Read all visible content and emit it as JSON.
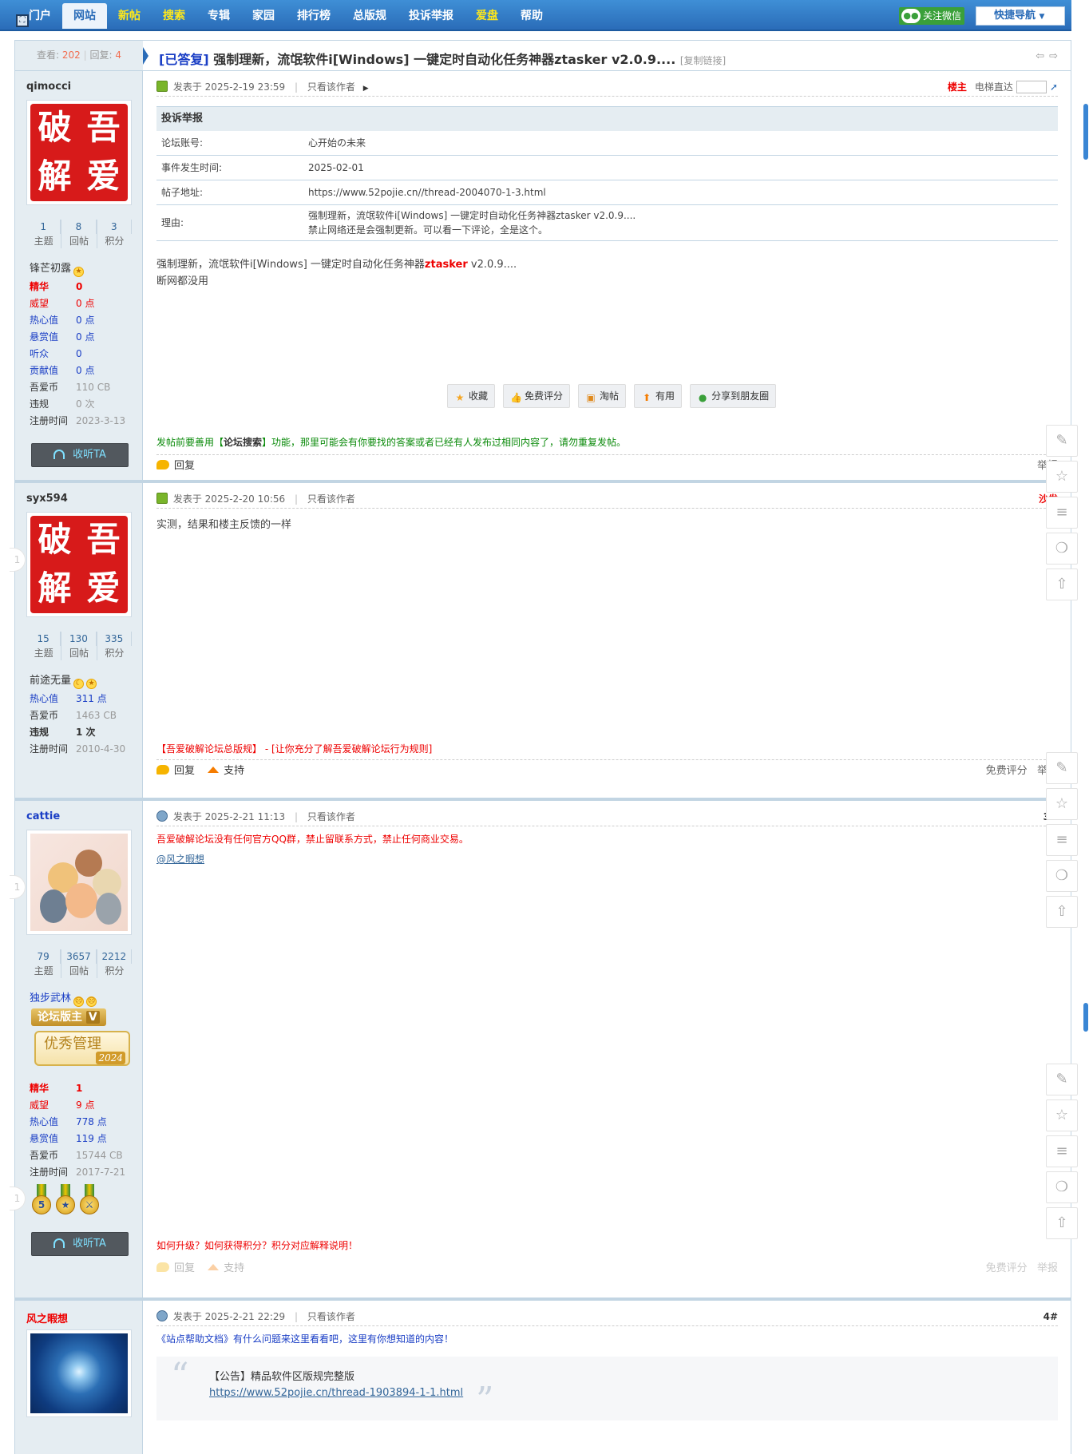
{
  "nav": {
    "items": [
      "门户",
      "网站",
      "新帖",
      "搜索",
      "专辑",
      "家园",
      "排行榜",
      "总版规",
      "投诉举报",
      "爱盘",
      "帮助"
    ],
    "wechat": "关注微信",
    "quick_nav": "快捷导航"
  },
  "thread": {
    "view_label": "查看:",
    "views": "202",
    "reply_label": "回复:",
    "replies": "4",
    "answered": "[已答复]",
    "title": "强制理新，流氓软件i[Windows] 一键定时自动化任务神器ztasker v2.0.9....",
    "copy_link": "[复制链接]"
  },
  "common": {
    "posted_at": "发表于",
    "only_author": "只看该作者",
    "reply": "回复",
    "support": "支持",
    "free_rate": "免费评分",
    "report": "举报",
    "follow": "收听TA",
    "elevator": "电梯直达",
    "topics": "主题",
    "posts": "回帖",
    "points": "积分"
  },
  "posts": [
    {
      "user": "qimocci",
      "stats": [
        "1",
        "8",
        "3"
      ],
      "rank": "锋芒初露",
      "info": [
        {
          "k": "精华",
          "v": "0"
        },
        {
          "k": "威望",
          "v": "0 点"
        },
        {
          "k": "热心值",
          "v": "0 点"
        },
        {
          "k": "悬赏值",
          "v": "0 点"
        },
        {
          "k": "听众",
          "v": "0"
        },
        {
          "k": "贡献值",
          "v": "0 点"
        },
        {
          "k": "吾爱币",
          "v": "110 CB"
        },
        {
          "k": "违规",
          "v": "0 次"
        },
        {
          "k": "注册时间",
          "v": "2023-3-13"
        }
      ],
      "time": "2025-2-19 23:59",
      "floor": "楼主",
      "report": {
        "title": "投诉举报",
        "rows": [
          {
            "k": "论坛账号:",
            "v": "心开始の未来"
          },
          {
            "k": "事件发生时间:",
            "v": "2025-02-01"
          },
          {
            "k": "帖子地址:",
            "v": "https://www.52pojie.cn//thread-2004070-1-3.html"
          },
          {
            "k": "理由:",
            "v": "强制理新，流氓软件i[Windows] 一键定时自动化任务神器ztasker v2.0.9....",
            "v2": "禁止网络还是会强制更新。可以看一下评论，全是这个。"
          }
        ]
      },
      "body_pre": "强制理新，流氓软件i[Windows] 一键定时自动化任务神器",
      "body_hl": "ztasker",
      "body_post": " v2.0.9....",
      "body_line2": "断网都没用",
      "actions": [
        "收藏",
        "免费评分",
        "淘帖",
        "有用",
        "分享到朋友圈"
      ],
      "tip_pre": "发帖前要善用【",
      "tip_b": "论坛搜索",
      "tip_post": "】功能，那里可能会有你要找的答案或者已经有人发布过相同内容了，请勿重复发帖。"
    },
    {
      "user": "syx594",
      "stats": [
        "15",
        "130",
        "335"
      ],
      "rank": "前途无量",
      "info": [
        {
          "k": "热心值",
          "v": "311 点"
        },
        {
          "k": "吾爱币",
          "v": "1463 CB"
        },
        {
          "k": "违规",
          "v": "1 次"
        },
        {
          "k": "注册时间",
          "v": "2010-4-30"
        }
      ],
      "time": "2025-2-20 10:56",
      "floor": "沙发",
      "body": "实测，结果和楼主反馈的一样",
      "notice": "【吾爱破解论坛总版规】 - [让你充分了解吾爱破解论坛行为规则]"
    },
    {
      "user": "cattie",
      "stats": [
        "79",
        "3657",
        "2212"
      ],
      "rank": "独步武林",
      "badge1": "论坛版主",
      "badge2": "优秀管理",
      "badge2_year": "2024",
      "info": [
        {
          "k": "精华",
          "v": "1"
        },
        {
          "k": "威望",
          "v": "9 点"
        },
        {
          "k": "热心值",
          "v": "778 点"
        },
        {
          "k": "悬赏值",
          "v": "119 点"
        },
        {
          "k": "吾爱币",
          "v": "15744 CB"
        },
        {
          "k": "注册时间",
          "v": "2017-7-21"
        }
      ],
      "medal_num": "5",
      "time": "2025-2-21 11:13",
      "floor": "3#",
      "body": "吾爱破解论坛没有任何官方QQ群，禁止留联系方式，禁止任何商业交易。",
      "mention": "@风之暇想",
      "notice": "如何升级？如何获得积分？积分对应解释说明！"
    },
    {
      "user": "风之暇想",
      "time": "2025-2-21 22:29",
      "floor": "4#",
      "body": "《站点帮助文档》有什么问题来这里看看吧，这里有你想知道的内容！",
      "quote_title": "【公告】精品软件区版规完整版",
      "quote_url": "https://www.52pojie.cn/thread-1903894-1-1.html"
    }
  ],
  "floor_nums": [
    "1",
    "1",
    "1"
  ],
  "icons": [
    "edit-icon",
    "star-icon",
    "menu-icon",
    "wechat-icon",
    "top-icon"
  ]
}
